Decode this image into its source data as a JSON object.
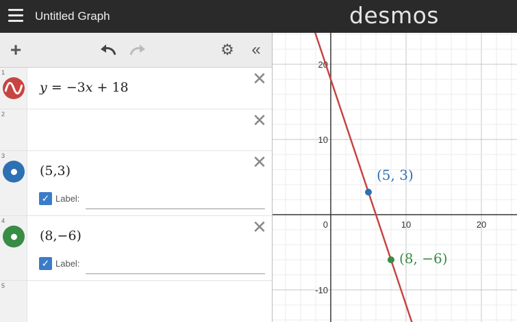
{
  "topbar": {
    "title": "Untitled Graph",
    "brand": "desmos"
  },
  "toolbar": {
    "add": "+",
    "gear": "⚙",
    "collapse": "«"
  },
  "expressions": [
    {
      "number": "1",
      "latex_parts": {
        "y": "y",
        "rest": " = −3",
        "x": "x",
        "tail": " + 18"
      },
      "color": "#c74440",
      "type": "function"
    },
    {
      "number": "2",
      "empty": true
    },
    {
      "number": "3",
      "text": "(5,3)",
      "color": "#2d70b3",
      "type": "point",
      "label_checkbox": "Label:"
    },
    {
      "number": "4",
      "text": "(8,−6)",
      "color": "#388c46",
      "type": "point",
      "label_checkbox": "Label:"
    },
    {
      "number": "5",
      "empty": true
    }
  ],
  "graph": {
    "x_ticks": [
      "0",
      "10",
      "20"
    ],
    "y_ticks": [
      "20",
      "10",
      "-10"
    ],
    "point_labels": [
      "(5, 3)",
      "(8, −6)"
    ],
    "line_color": "#c74440",
    "point1_color": "#2d70b3",
    "point2_color": "#388c46"
  },
  "chart_data": {
    "type": "line",
    "series": [
      {
        "values": [
          [
            -3,
            27
          ],
          [
            11,
            -15
          ]
        ]
      }
    ],
    "points": [
      {
        "x": 5,
        "y": 3,
        "label": "(5, 3)"
      },
      {
        "x": 8,
        "y": -6,
        "label": "(8, −6)"
      }
    ],
    "xlim": [
      -7,
      23
    ],
    "ylim": [
      -14,
      24
    ],
    "grid": true
  }
}
